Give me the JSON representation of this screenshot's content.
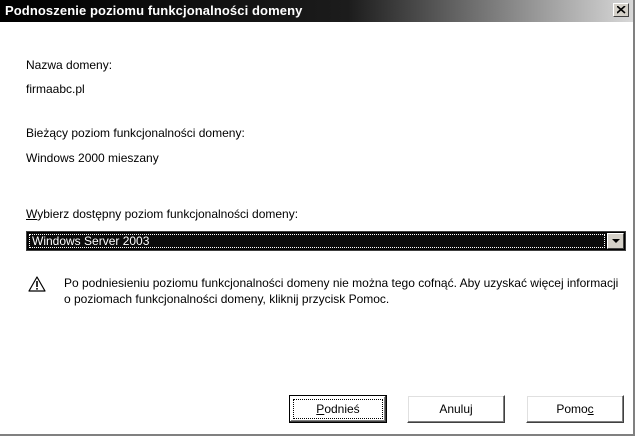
{
  "window": {
    "title": "Podnoszenie poziomu funkcjonalności domeny",
    "close_icon": "close-icon"
  },
  "domain": {
    "name_label": "Nazwa domeny:",
    "name_value": "firmaabc.pl",
    "current_level_label": "Bieżący poziom funkcjonalności domeny:",
    "current_level_value": "Windows 2000 mieszany"
  },
  "select": {
    "label_accel": "W",
    "label_rest": "ybierz dostępny poziom funkcjonalności domeny:",
    "selected_value": "Windows Server 2003"
  },
  "warning": {
    "icon": "warning-icon",
    "text": "Po podniesieniu poziomu funkcjonalności domeny nie można tego cofnąć. Aby uzyskać więcej informacji o poziomach funkcjonalności domeny, kliknij przycisk Pomoc."
  },
  "buttons": {
    "raise_accel": "P",
    "raise_rest": "odnieś",
    "cancel": "Anuluj",
    "help_main": "Pomo",
    "help_accel": "c"
  }
}
